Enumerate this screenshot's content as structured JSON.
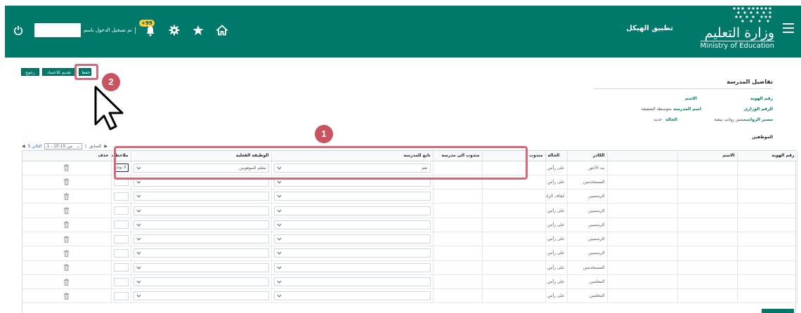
{
  "caption": "",
  "header": {
    "app_title": "تطبيق الهيكل",
    "logo_ar": "وزارة التعليم",
    "logo_en": "Ministry of Education",
    "logged_in_as": "تم تسجيل الدخول باسم",
    "notifications_badge": "+99"
  },
  "actions": {
    "back": "رجوع",
    "submit": "تقديم للاعتماد",
    "save": "حفظ"
  },
  "annotations": {
    "step1": "1",
    "step2": "2"
  },
  "details": {
    "title": "تفاصيل المدرسة",
    "id_label": "رقم الهوية",
    "name_label": "الاسم",
    "ministry_no_label": "الرقم الوزاري",
    "school_name_label": "اسم المدرسة",
    "school_name_value": "متوسطة الشقيقة",
    "payroll_label": "مسير الرواتب",
    "payroll_value": "مسير رواتب بيشة",
    "status_label": "الحالة",
    "status_value": "جديد",
    "staff_label": "الموظفين"
  },
  "pager": {
    "prev": "السابق",
    "range": "1 - 10 من 15",
    "next": "التالي 5"
  },
  "table": {
    "columns": {
      "id": "رقم الهوية",
      "name": "الاسم",
      "cadre": "الكادر",
      "status": "الحالة",
      "seconded": "مندوب",
      "seconded_to": "مندوب الى مدرسة",
      "belongs": "تابع للمدرسة",
      "actual_job": "الوظيفة الفعلية",
      "notes": "ملاحظات",
      "delete": "حذف"
    },
    "rows": [
      {
        "cadre": "بند الأجور",
        "status": "على رأس العمل",
        "belongs": "نعم",
        "job": "معلم الموهوبين",
        "notes": "لا يوجد"
      },
      {
        "cadre": "المستخدمين",
        "status": "على رأس العمل",
        "belongs": "",
        "job": "",
        "notes": ""
      },
      {
        "cadre": "الرسميين",
        "status": "ايقاف الراتب مؤقتا",
        "belongs": "",
        "job": "",
        "notes": ""
      },
      {
        "cadre": "الرسميين",
        "status": "على رأس العمل",
        "belongs": "",
        "job": "",
        "notes": ""
      },
      {
        "cadre": "الرسميين",
        "status": "على رأس العمل",
        "belongs": "",
        "job": "",
        "notes": ""
      },
      {
        "cadre": "الرسميين",
        "status": "على رأس العمل",
        "belongs": "",
        "job": "",
        "notes": ""
      },
      {
        "cadre": "الرسميين",
        "status": "على رأس العمل",
        "belongs": "",
        "job": "",
        "notes": ""
      },
      {
        "cadre": "المستخدمين",
        "status": "على رأس العمل",
        "belongs": "",
        "job": "",
        "notes": ""
      },
      {
        "cadre": "المعلمين",
        "status": "على رأس العمل",
        "belongs": "",
        "job": "",
        "notes": ""
      },
      {
        "cadre": "المعلمين",
        "status": "على رأس العمل",
        "belongs": "",
        "job": "",
        "notes": ""
      }
    ]
  },
  "icons": {
    "menu": "menu-icon",
    "power": "power-icon",
    "bell": "bell-icon",
    "gear": "gear-icon",
    "star": "star-icon",
    "home": "home-icon",
    "trash": "trash-icon",
    "chevron": "chevron-down-icon"
  },
  "colors": {
    "header": "#00796b",
    "accent": "#00796b",
    "highlight": "#d26a77",
    "badge": "#f2d13a"
  }
}
